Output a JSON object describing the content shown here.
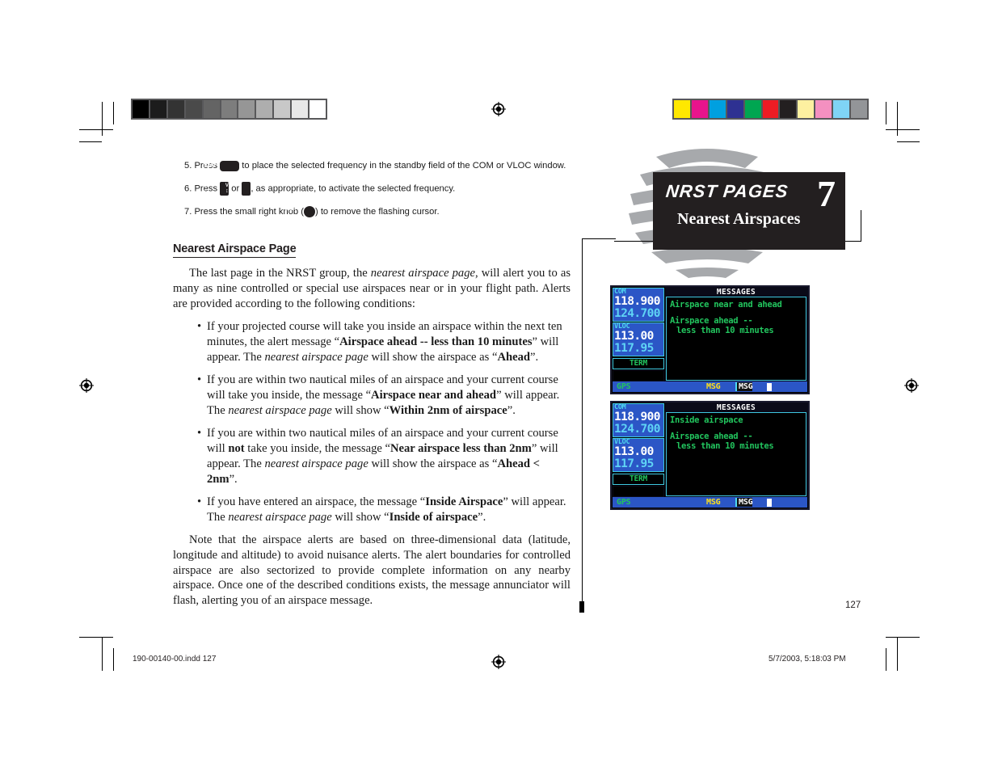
{
  "page": {
    "number": "127",
    "footer_file": "190-00140-00.indd   127",
    "footer_timestamp": "5/7/2003, 5:18:03 PM"
  },
  "chapter_tab": {
    "title": "NRST PAGES",
    "number": "7",
    "subtitle": "Nearest Airspaces"
  },
  "steps": [
    {
      "num": "5. Press",
      "key": "ENT",
      "key_type": "ent",
      "after": "to place the selected frequency in the standby field of the COM or VLOC window."
    },
    {
      "num": "6. Press",
      "key": "C",
      "key_type": "toggle",
      "key2": "V",
      "mid": "or",
      "after": ", as appropriate, to activate the selected frequency."
    },
    {
      "num": "7. Press the small right knob (",
      "key": "CRSR",
      "key_type": "knob",
      "after": ") to remove the flashing cursor."
    }
  ],
  "section": {
    "heading": "Nearest Airspace Page",
    "intro": "The last page in the NRST group, the nearest airspace page, will alert you to as many as nine controlled or special use airspaces near or in your flight path. Alerts are provided according to the following conditions:",
    "bullets": [
      "If your projected course will take you inside an airspace within the next ten minutes, the alert message “Airspace ahead -- less than 10 minutes” will appear. The nearest airspace page will show the airspace as “Ahead”.",
      "If you are within two nautical miles of an airspace and your current course will take you inside, the message “Airspace near and ahead” will appear. The nearest airspace page will show “Within 2nm of airspace”.",
      "If you are within two nautical miles of an airspace and your current course will not take you inside, the message “Near airspace less than 2nm” will appear. The nearest airspace page will show the airspace as “Ahead < 2nm”.",
      "If you have entered an airspace, the message “Inside Airspace” will appear. The nearest airspace page will show “Inside of airspace”."
    ],
    "note": "Note that the airspace alerts are based on three-dimensional data (latitude, longitude and altitude) to avoid nuisance alerts. The alert boundaries for controlled airspace are also sectorized to provide complete information on any nearby airspace. Once one of the described conditions exists, the message annunciator will flash, alerting you of an airspace message."
  },
  "gps_screens": [
    {
      "name": "messages-screen-1",
      "com": {
        "label": "COM",
        "active": "118.900",
        "standby": "124.700"
      },
      "vloc": {
        "label": "VLOC",
        "active": "113.00",
        "standby": "117.95"
      },
      "mode": "TERM",
      "header": "MESSAGES",
      "messages": [
        "Airspace near and ahead",
        "Airspace ahead --",
        "less than 10 minutes"
      ],
      "footer": {
        "left": "GPS",
        "alert": "MSG",
        "page": "MSG"
      }
    },
    {
      "name": "messages-screen-2",
      "com": {
        "label": "COM",
        "active": "118.900",
        "standby": "124.700"
      },
      "vloc": {
        "label": "VLOC",
        "active": "113.00",
        "standby": "117.95"
      },
      "mode": "TERM",
      "header": "MESSAGES",
      "messages": [
        "Inside airspace",
        "Airspace ahead --",
        "less than 10 minutes"
      ],
      "footer": {
        "left": "GPS",
        "alert": "MSG",
        "page": "MSG"
      }
    }
  ],
  "calibration": {
    "grayscale": [
      "#000000",
      "#1c1c1c",
      "#333333",
      "#4a4a4a",
      "#646464",
      "#7d7d7d",
      "#969696",
      "#aeaeae",
      "#c8c8c8",
      "#e8e8e8",
      "#ffffff"
    ],
    "colors": [
      "#ffe800",
      "#e8148c",
      "#00a0e0",
      "#2e3192",
      "#00a651",
      "#ed1c24",
      "#231f20",
      "#fdf0a0",
      "#f490c0",
      "#7fd4f5",
      "#939598"
    ]
  }
}
